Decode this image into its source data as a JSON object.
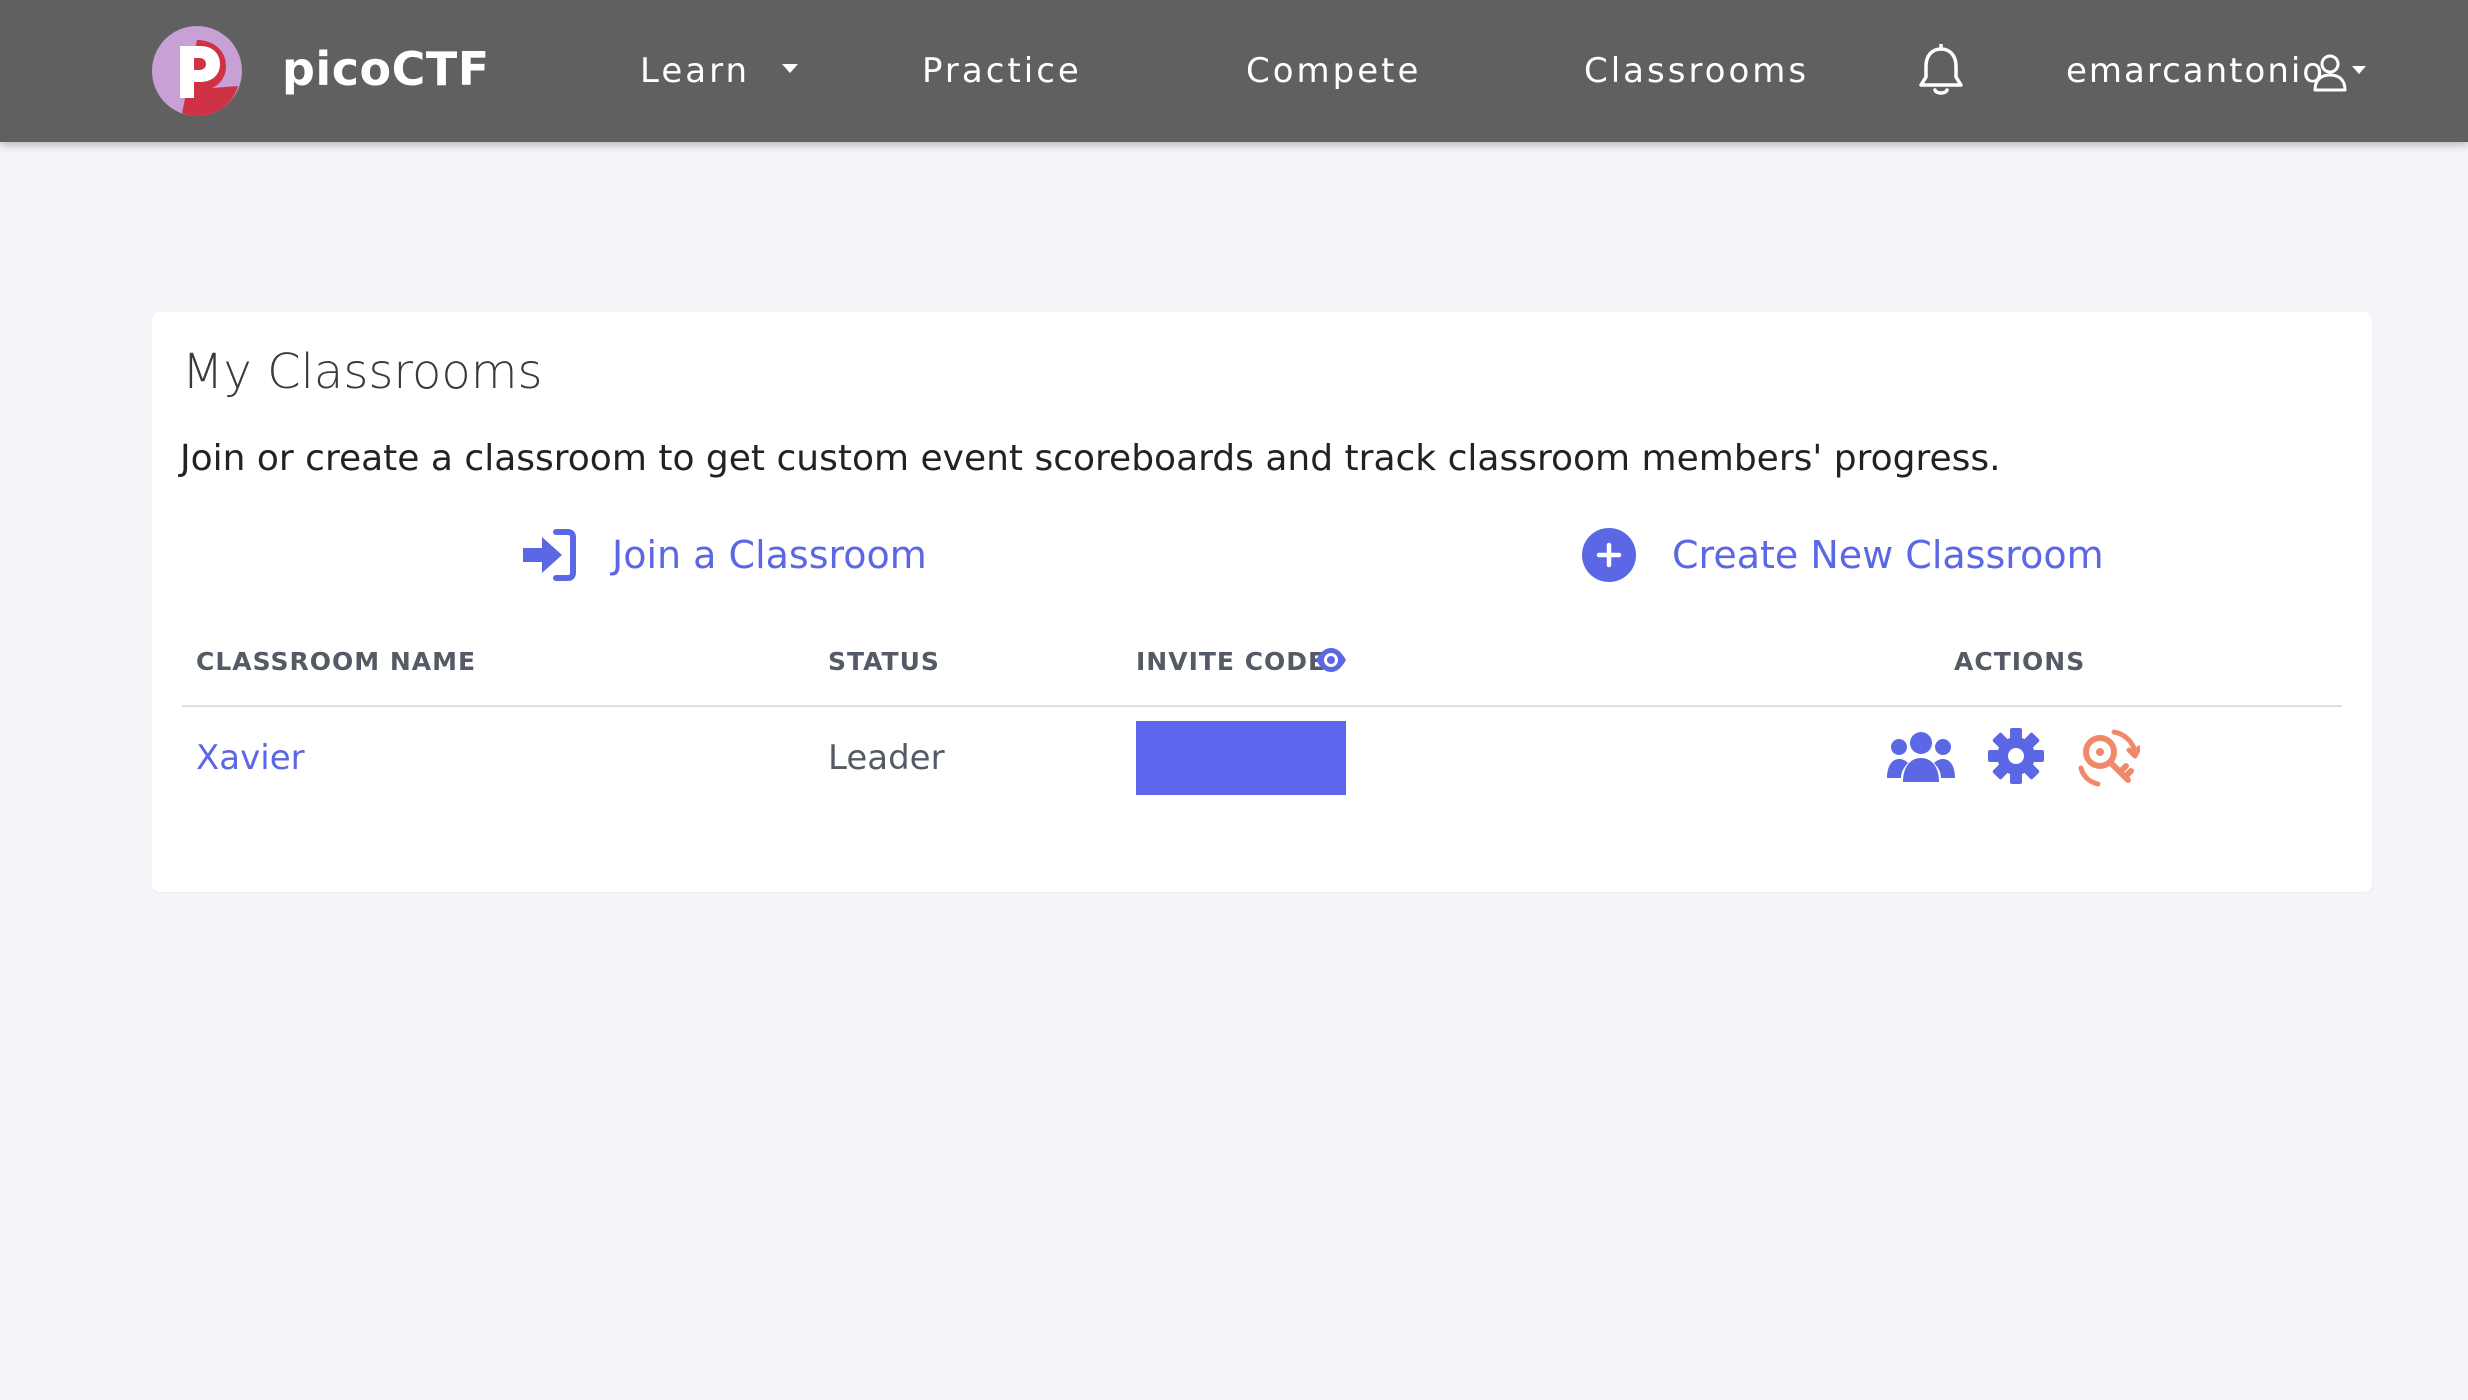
{
  "brand": {
    "logo_letter": "P",
    "name": "picoCTF",
    "logo_colors": {
      "circle": "#c7a0d6",
      "shape": "#d03245",
      "letter": "#ffffff"
    }
  },
  "nav": {
    "learn": "Learn",
    "practice": "Practice",
    "compete": "Compete",
    "classrooms": "Classrooms",
    "bell_icon": "bell-icon",
    "username": "emarcantonio",
    "user_icon": "user-icon"
  },
  "page": {
    "title": "My Classrooms",
    "description": "Join or create a classroom to get custom event scoreboards and track classroom members' progress.",
    "join_label": "Join a Classroom",
    "join_icon": "sign-in-icon",
    "create_label": "Create New Classroom",
    "create_icon": "plus-circle-icon"
  },
  "table": {
    "headers": {
      "name": "CLASSROOM NAME",
      "status": "STATUS",
      "invite_code": "INVITE CODE",
      "actions": "ACTIONS"
    },
    "reveal_icon": "eye-icon",
    "rows": [
      {
        "name": "Xavier",
        "status": "Leader",
        "invite_code_hidden": true,
        "actions": [
          "members-icon",
          "settings-gear-icon",
          "transfer-key-icon"
        ]
      }
    ]
  },
  "colors": {
    "navbar": "#606060",
    "background": "#f4f5f9",
    "accent": "#5c67e5",
    "transfer": "#f0896a",
    "redaction": "#5c67ee"
  }
}
